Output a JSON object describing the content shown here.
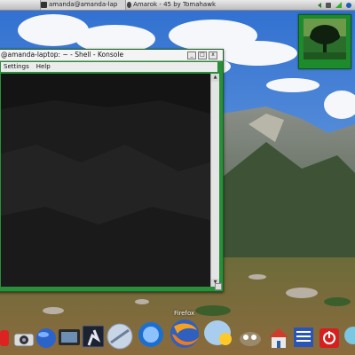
{
  "top_panel": {
    "tasks": [
      {
        "label": "amanda@amanda-lap",
        "icon": "terminal-icon"
      },
      {
        "label": "Amarok - 45 by Tomahawk",
        "icon": "amarok-icon"
      }
    ],
    "tray_icons": [
      "arrow-left-icon",
      "speaker-icon",
      "network-icon",
      "update-icon"
    ]
  },
  "widget": {
    "caption": "",
    "icon": "tree-photo"
  },
  "window": {
    "title": "@amanda-laptop: ~ - Shell - Konsole",
    "menu_items": [
      "Settings",
      "Help"
    ],
    "buttons": {
      "minimize": "_",
      "maximize": "□",
      "close": "x"
    }
  },
  "dock": {
    "hover_label": "Firefox",
    "items": [
      "app-icon",
      "screenshot-icon",
      "globe-icon",
      "display-icon",
      "terminal-icon",
      "media-icon",
      "finder-icon",
      "firefox-icon",
      "chat-icon",
      "gimp-icon",
      "home-icon",
      "document-icon",
      "power-icon",
      "network-icon"
    ]
  },
  "colors": {
    "window_frame": "#2a8f3a",
    "terminal_bg": "#111111",
    "panel": "#d4d4d4",
    "accent": "#1d8a2c"
  }
}
